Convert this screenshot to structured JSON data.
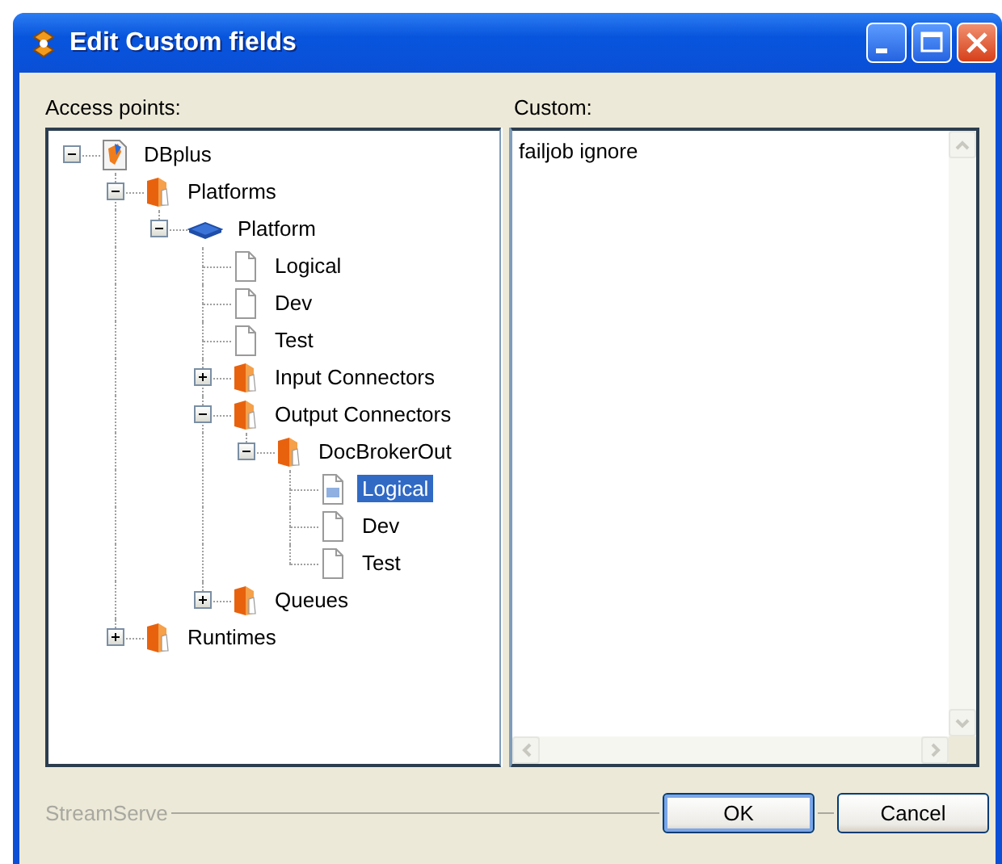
{
  "window": {
    "title": "Edit Custom fields"
  },
  "access_points": {
    "label": "Access points:",
    "tree": [
      {
        "label": "DBplus",
        "kind": "root",
        "selected": false,
        "expanded": true,
        "children": [
          {
            "label": "Platforms",
            "kind": "folder",
            "selected": false,
            "expanded": true,
            "children": [
              {
                "label": "Platform",
                "kind": "platform",
                "selected": false,
                "expanded": true,
                "children": [
                  {
                    "label": "Logical",
                    "kind": "doc",
                    "selected": false
                  },
                  {
                    "label": "Dev",
                    "kind": "doc",
                    "selected": false
                  },
                  {
                    "label": "Test",
                    "kind": "doc",
                    "selected": false
                  },
                  {
                    "label": "Input Connectors",
                    "kind": "folder",
                    "selected": false,
                    "expanded": false
                  },
                  {
                    "label": "Output Connectors",
                    "kind": "folder",
                    "selected": false,
                    "expanded": true,
                    "children": [
                      {
                        "label": "DocBrokerOut",
                        "kind": "folder",
                        "selected": false,
                        "expanded": true,
                        "children": [
                          {
                            "label": "Logical",
                            "kind": "doc",
                            "selected": true
                          },
                          {
                            "label": "Dev",
                            "kind": "doc",
                            "selected": false
                          },
                          {
                            "label": "Test",
                            "kind": "doc",
                            "selected": false
                          }
                        ]
                      }
                    ]
                  },
                  {
                    "label": "Queues",
                    "kind": "folder",
                    "selected": false,
                    "expanded": false
                  }
                ]
              }
            ]
          },
          {
            "label": "Runtimes",
            "kind": "folder",
            "selected": false,
            "expanded": false
          }
        ]
      }
    ]
  },
  "custom": {
    "label": "Custom:",
    "value": "failjob ignore"
  },
  "footer": {
    "brand": "StreamServe"
  },
  "buttons": [
    {
      "label": "OK",
      "default": true
    },
    {
      "label": "Cancel",
      "default": false
    }
  ]
}
